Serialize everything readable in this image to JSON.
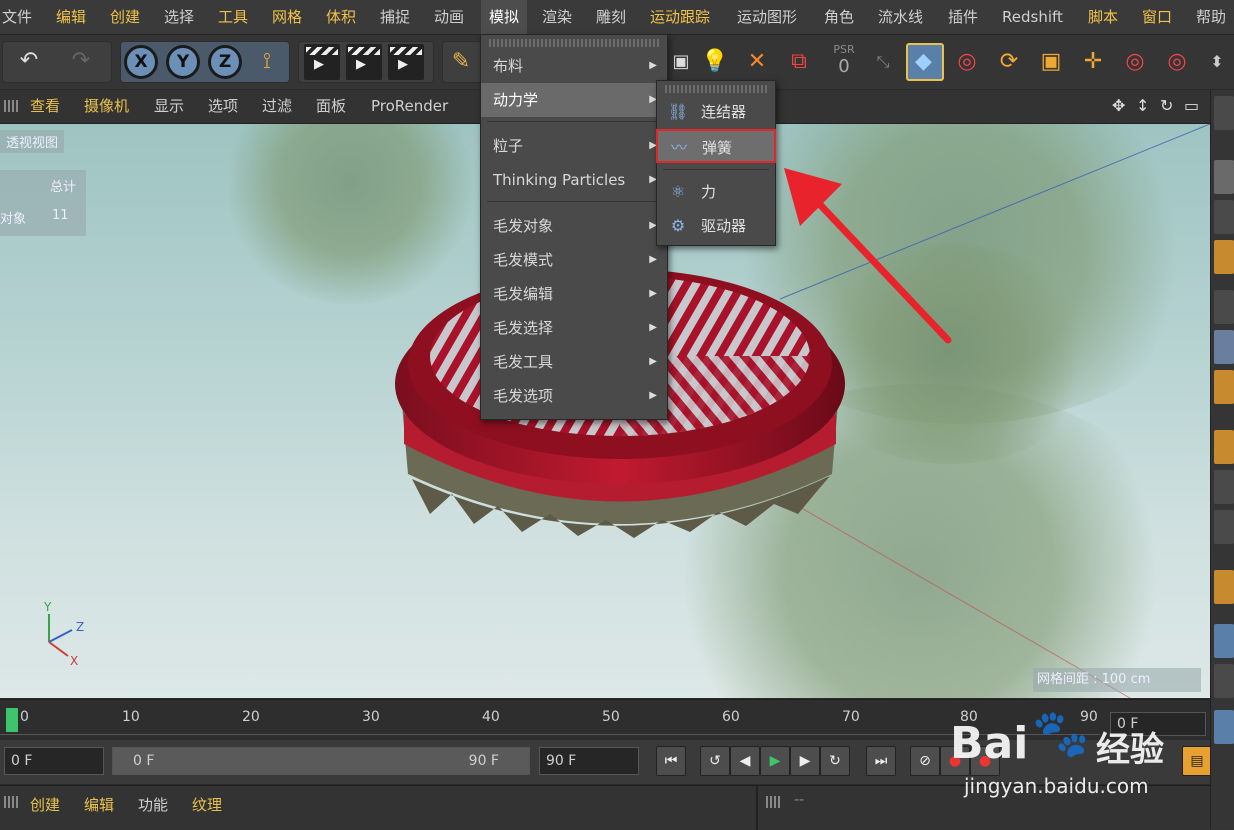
{
  "menubar": {
    "items": [
      "文件",
      "编辑",
      "创建",
      "选择",
      "工具",
      "网格",
      "体积",
      "捕捉",
      "动画",
      "模拟",
      "渲染",
      "雕刻",
      "运动跟踪",
      "运动图形",
      "角色",
      "流水线",
      "插件",
      "Redshift",
      "脚本",
      "窗口",
      "帮助"
    ],
    "open_item": "模拟"
  },
  "toolbar": {
    "axis_x": "X",
    "axis_y": "Y",
    "axis_z": "Z",
    "psr_label": "PSR",
    "psr_value": "0"
  },
  "viewbar": {
    "items": [
      "查看",
      "摄像机",
      "显示",
      "选项",
      "过滤",
      "面板",
      "ProRender"
    ]
  },
  "viewport": {
    "view_name": "透视视图",
    "hud_total_label": "总计",
    "hud_objects_label": "对象",
    "hud_objects_value": "11",
    "grid_spacing": "网格间距 : 100 cm",
    "axis_y": "Y",
    "axis_z": "Z",
    "axis_x": "X"
  },
  "sim_menu": {
    "items": [
      {
        "label": "布料",
        "submenu": true
      },
      {
        "label": "动力学",
        "submenu": true,
        "active": true
      },
      {
        "label": "粒子",
        "submenu": true
      },
      {
        "label": "Thinking Particles",
        "submenu": true
      },
      {
        "label": "毛发对象",
        "submenu": true
      },
      {
        "label": "毛发模式",
        "submenu": true
      },
      {
        "label": "毛发编辑",
        "submenu": true
      },
      {
        "label": "毛发选择",
        "submenu": true
      },
      {
        "label": "毛发工具",
        "submenu": true
      },
      {
        "label": "毛发选项",
        "submenu": true
      }
    ]
  },
  "dynamics_submenu": {
    "items": [
      {
        "label": "连结器",
        "icon": "connector-icon"
      },
      {
        "label": "弹簧",
        "icon": "spring-icon",
        "selected": true
      },
      {
        "label": "力",
        "icon": "force-icon"
      },
      {
        "label": "驱动器",
        "icon": "motor-icon"
      }
    ]
  },
  "timeline": {
    "ticks": [
      "0",
      "10",
      "20",
      "30",
      "40",
      "50",
      "60",
      "70",
      "80",
      "90"
    ],
    "current_frame_field": "0 F"
  },
  "transport": {
    "start_field": "0 F",
    "range_start": "0 F",
    "range_end": "90 F",
    "end_field": "90 F"
  },
  "bottombar": {
    "items": [
      "创建",
      "编辑",
      "功能",
      "纹理"
    ],
    "right_label": "--"
  },
  "watermark": {
    "brand": "Bai",
    "brand2": "经验",
    "url": "jingyan.baidu.com"
  },
  "colors": {
    "accent_yellow": "#e8c24d",
    "highlight_red": "#e0262a",
    "arrow_red": "#e8232c"
  }
}
